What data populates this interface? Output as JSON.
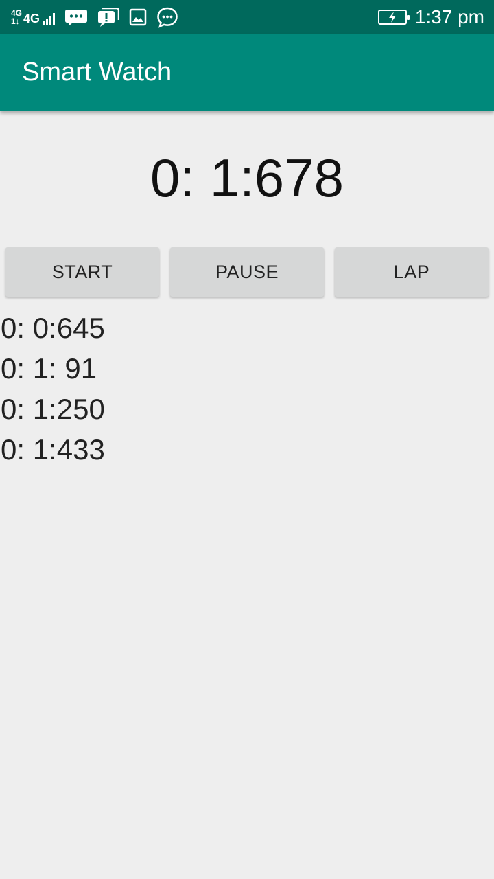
{
  "status_bar": {
    "net_top": "4G",
    "net_bottom": "1↓",
    "net_main": "4G",
    "signal_bars": 4,
    "notification_icons": [
      "chat-bubble-icon",
      "alert-message-icon",
      "image-icon",
      "message-dots-icon"
    ],
    "battery": "charging",
    "time": "1:37 pm"
  },
  "app_bar": {
    "title": "Smart Watch"
  },
  "timer": {
    "display": "0: 1:678"
  },
  "buttons": {
    "start": "START",
    "pause": "PAUSE",
    "lap": "LAP"
  },
  "laps": [
    "0: 0:645",
    "0: 1: 91",
    "0: 1:250",
    "0: 1:433"
  ],
  "colors": {
    "status_bar": "#00695c",
    "app_bar": "#00897b",
    "background": "#eeeeee",
    "button": "#d6d7d7"
  }
}
